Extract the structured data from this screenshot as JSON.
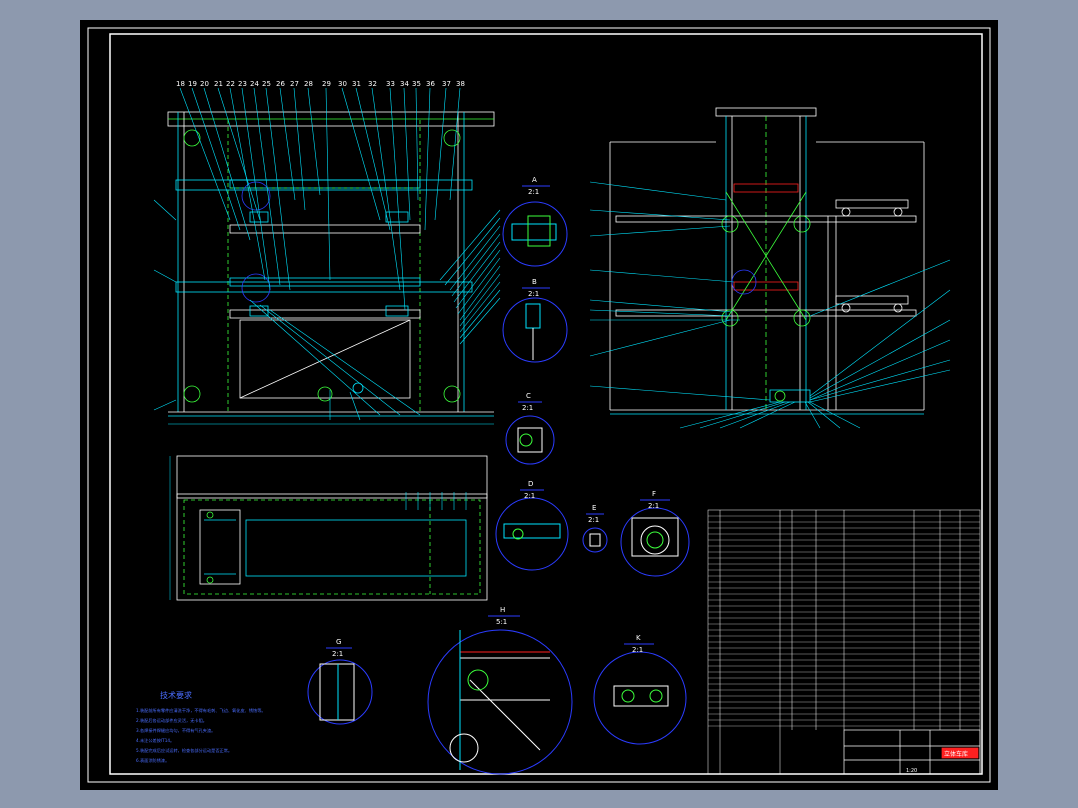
{
  "drawing": {
    "viewport_bg": "#000000",
    "page_bg": "#8d99ae",
    "colors": {
      "frame": "#ffffff",
      "cyan": "#00e5ff",
      "green": "#3cff3c",
      "blue": "#2b3cff",
      "red": "#ff2020",
      "white": "#ffffff"
    },
    "detail_views": [
      {
        "id": "a",
        "label": "A",
        "scale": "2:1"
      },
      {
        "id": "b",
        "label": "B",
        "scale": "2:1"
      },
      {
        "id": "c",
        "label": "C",
        "scale": "2:1"
      },
      {
        "id": "d",
        "label": "D",
        "scale": "2:1"
      },
      {
        "id": "e",
        "label": "E",
        "scale": "2:1"
      },
      {
        "id": "f",
        "label": "F",
        "scale": "2:1"
      },
      {
        "id": "g",
        "label": "G",
        "scale": "2:1"
      },
      {
        "id": "h",
        "label": "H",
        "scale": "5:1"
      },
      {
        "id": "k",
        "label": "K",
        "scale": "2:1"
      }
    ],
    "tech_requirements": {
      "title": "技术要求",
      "lines": [
        "1.装配前所有零件应清洗干净，不得有毛刺、飞边、氧化皮、锈蚀等。",
        "2.装配后各运动部件应灵活，无卡阻。",
        "3.各焊接件焊缝应均匀，不得有气孔夹渣。",
        "4.未注公差按IT14。",
        "5.装配完成后应试运转，检查各部分运动是否正常。",
        "6.表面涂防锈漆。"
      ]
    },
    "title_block": {
      "drawing_name": "立体车库",
      "scale": "1:20"
    }
  }
}
